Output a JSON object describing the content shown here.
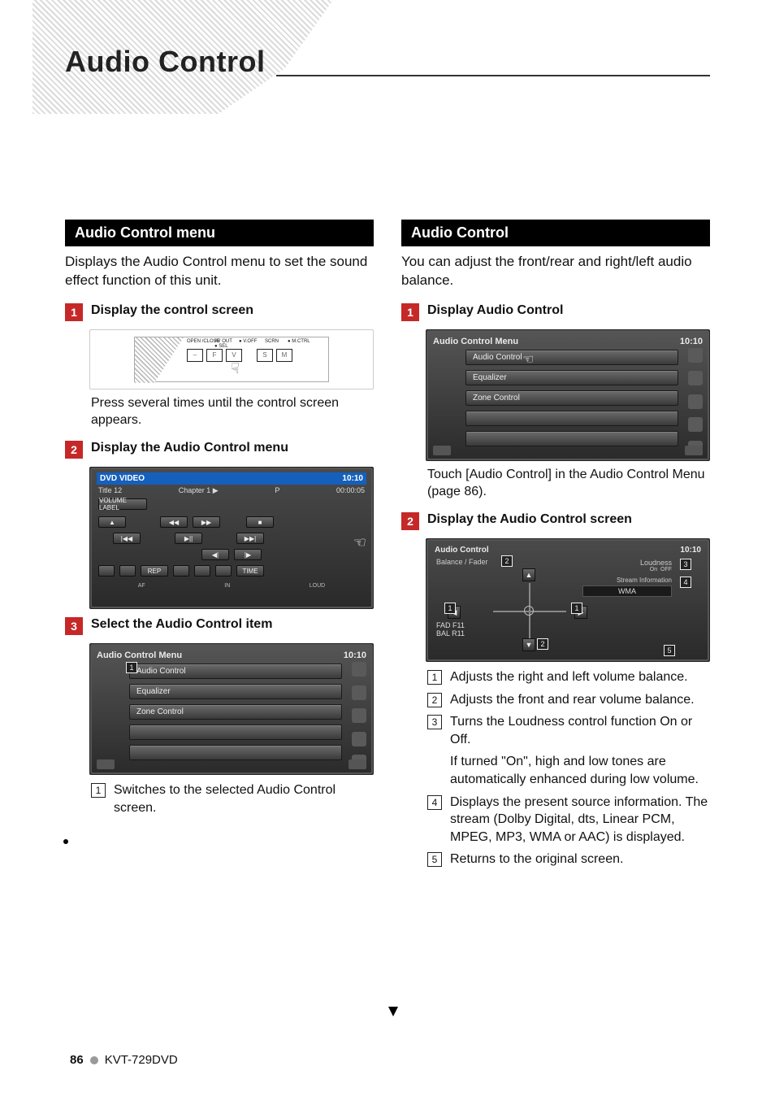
{
  "page": {
    "title": "Audio Control",
    "number": "86",
    "model": "KVT-729DVD"
  },
  "left": {
    "section_title": "Audio Control menu",
    "intro": "Displays the Audio Control menu to set the sound effect function of this unit.",
    "steps": [
      {
        "num": "1",
        "title": "Display the control screen"
      },
      {
        "num": "2",
        "title": "Display the Audio Control menu"
      },
      {
        "num": "3",
        "title": "Select the Audio Control item"
      }
    ],
    "step1_caption": "Press several times until the control screen appears.",
    "hw": {
      "open": "OPEN /CLOSE",
      "avout": "AV OUT",
      "sel": "● SEL",
      "voff": "● V.OFF",
      "scrn": "SCRN",
      "mctrl": "● M.CTRL",
      "minus": "–",
      "f": "F",
      "v": "V",
      "s": "S",
      "m": "M"
    },
    "dvd": {
      "title": "DVD VIDEO",
      "time": "10:10",
      "line1_left": "Title 12",
      "line1_mid": "Chapter   1   ▶",
      "line1_p": "P",
      "line1_time": "00:00:05",
      "vol": "VOLUME LABEL",
      "btns": [
        "▲",
        "◀◀",
        "▶▶",
        "■",
        "|◀◀",
        "▶||",
        "▶▶|",
        "◀|",
        "|▶"
      ],
      "rep": "REP",
      "timebtn": "TIME",
      "af": "AF",
      "in": "IN",
      "loud": "LOUD"
    },
    "menu_panel": {
      "title": "Audio Control Menu",
      "time": "10:10",
      "items": [
        "Audio Control",
        "Equalizer",
        "Zone Control"
      ],
      "callouts": [
        "1"
      ]
    },
    "step3_note": "Switches to the selected Audio Control screen.",
    "step3_note_num": "1"
  },
  "right": {
    "section_title": "Audio Control",
    "intro": "You can adjust the front/rear and right/left audio balance.",
    "steps": [
      {
        "num": "1",
        "title": "Display Audio Control"
      },
      {
        "num": "2",
        "title": "Display the Audio Control screen"
      }
    ],
    "step1_caption": "Touch [Audio Control] in the Audio Control Menu (page 86).",
    "menu_panel": {
      "title": "Audio Control Menu",
      "time": "10:10",
      "items": [
        "Audio Control",
        "Equalizer",
        "Zone Control"
      ]
    },
    "ac_panel": {
      "title": "Audio Control",
      "time": "10:10",
      "balance_label": "Balance / Fader",
      "loudness": "Loudness",
      "on": "On",
      "off": "OFF",
      "stream_label": "Stream Information",
      "stream_value": "WMA",
      "fad": "FAD F11",
      "bal": "BAL R11",
      "callouts": [
        "1",
        "2",
        "2",
        "3",
        "4",
        "5",
        "1"
      ]
    },
    "notes": [
      {
        "n": "1",
        "t": "Adjusts the right and left volume balance."
      },
      {
        "n": "2",
        "t": "Adjusts the front and rear volume balance."
      },
      {
        "n": "3",
        "t": "Turns the Loudness control function On or Off."
      },
      {
        "n": "3sub",
        "t": "If turned \"On\", high and low tones are automatically enhanced during low volume."
      },
      {
        "n": "4",
        "t": "Displays the present source information. The stream (Dolby Digital, dts, Linear PCM, MPEG, MP3, WMA or AAC) is displayed."
      },
      {
        "n": "5",
        "t": "Returns to the original screen."
      }
    ]
  }
}
